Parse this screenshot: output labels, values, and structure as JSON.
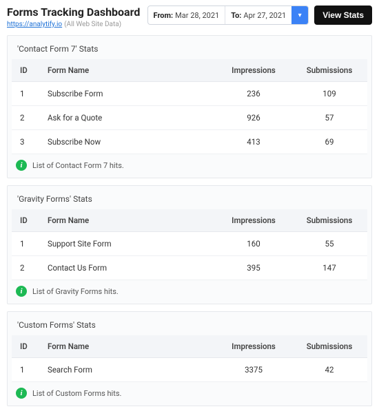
{
  "header": {
    "title": "Forms Tracking Dashboard",
    "site_link": "https://analytify.io",
    "site_note": "(All Web Site Data)",
    "date_from_label": "From:",
    "date_from": "Mar 28, 2021",
    "date_to_label": "To:",
    "date_to": "Apr 27, 2021",
    "view_stats_label": "View Stats"
  },
  "columns": {
    "id": "ID",
    "form_name": "Form Name",
    "impressions": "Impressions",
    "submissions": "Submissions"
  },
  "panels": [
    {
      "title": "'Contact Form 7' Stats",
      "footer": "List of Contact Form 7 hits.",
      "rows": [
        {
          "id": "1",
          "name": "Subscribe Form",
          "impressions": "236",
          "submissions": "109"
        },
        {
          "id": "2",
          "name": "Ask for a Quote",
          "impressions": "926",
          "submissions": "57"
        },
        {
          "id": "3",
          "name": "Subscribe Now",
          "impressions": "413",
          "submissions": "69"
        }
      ]
    },
    {
      "title": "'Gravity Forms' Stats",
      "footer": "List of Gravity Forms hits.",
      "rows": [
        {
          "id": "1",
          "name": "Support Site Form",
          "impressions": "160",
          "submissions": "55"
        },
        {
          "id": "2",
          "name": "Contact Us Form",
          "impressions": "395",
          "submissions": "147"
        }
      ]
    },
    {
      "title": "'Custom Forms' Stats",
      "footer": "List of Custom Forms hits.",
      "rows": [
        {
          "id": "1",
          "name": "Search Form",
          "impressions": "3375",
          "submissions": "42"
        }
      ]
    }
  ]
}
